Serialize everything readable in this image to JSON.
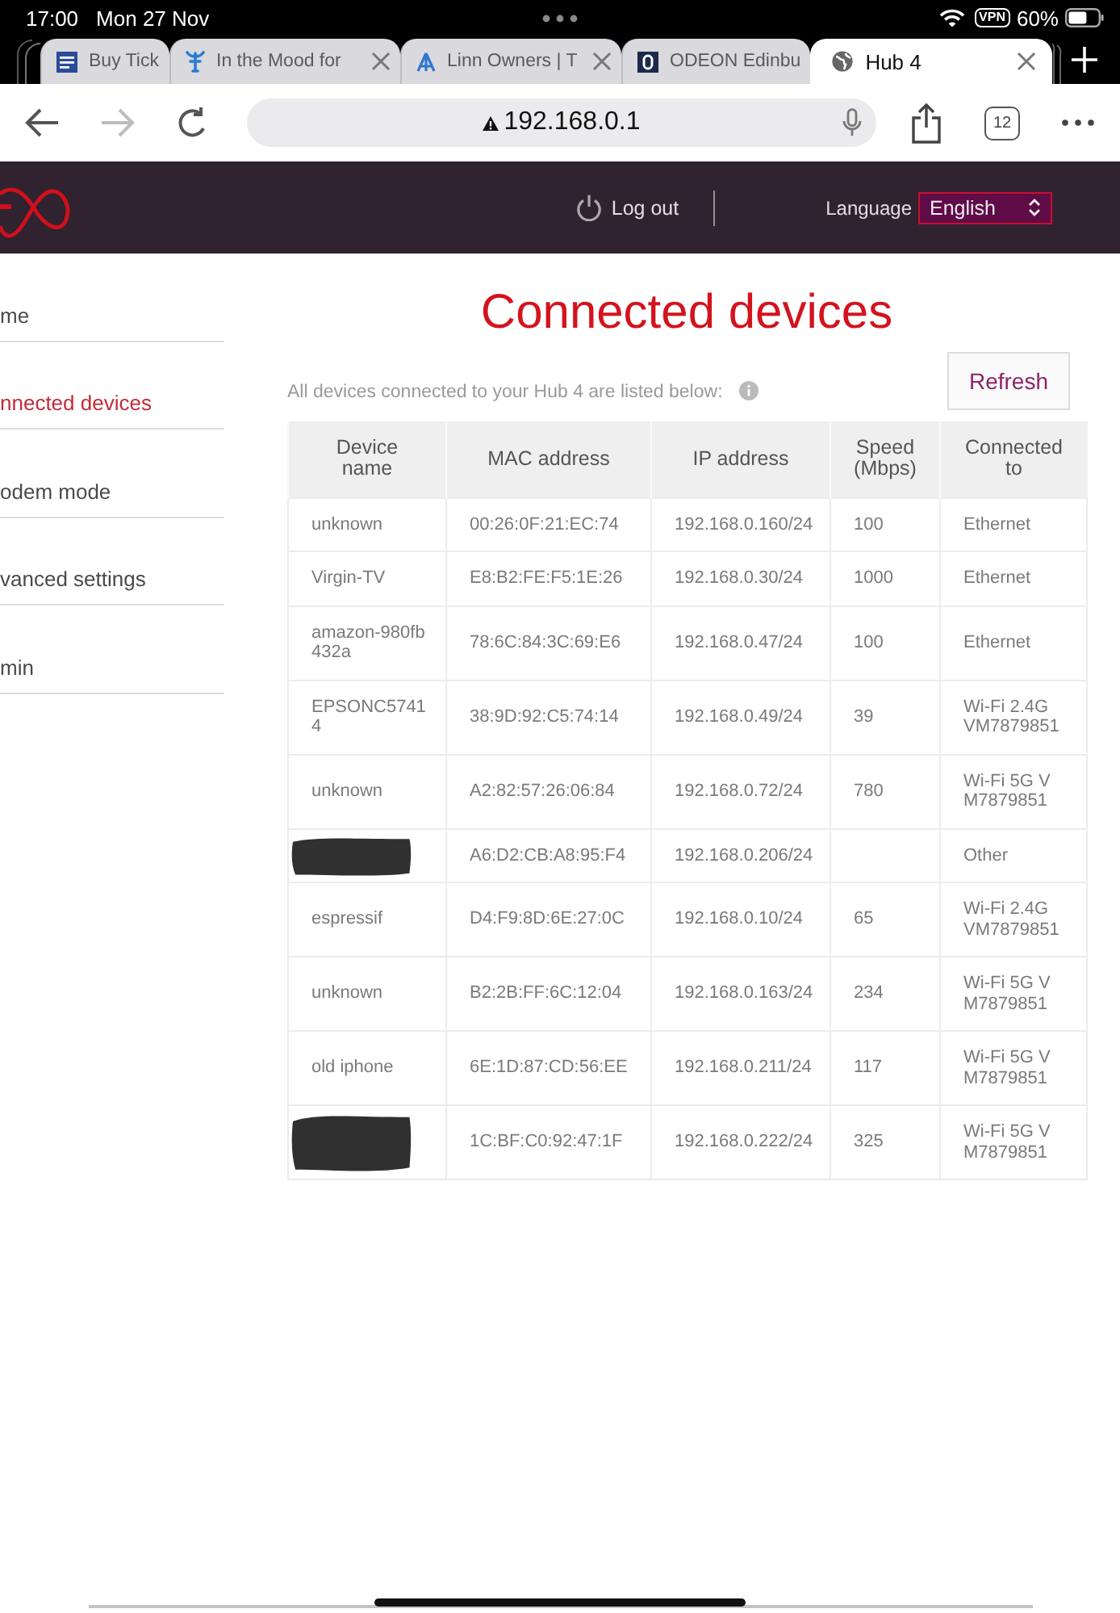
{
  "status_bar": {
    "time": "17:00",
    "date": "Mon 27 Nov",
    "vpn": "VPN",
    "battery": "60%"
  },
  "browser_tabs": [
    {
      "kind": "square",
      "title": "Buy Tick",
      "close_button": false,
      "selected": false
    },
    {
      "kind": "trident",
      "title": "In the Mood for",
      "close_button": true,
      "selected": false
    },
    {
      "kind": "triangle",
      "title": "Linn Owners | T",
      "close_button": true,
      "selected": false
    },
    {
      "kind": "ring",
      "title": "ODEON Edinbu",
      "close_button": false,
      "selected": false
    },
    {
      "kind": "globe",
      "title": "Hub 4",
      "close_button": true,
      "selected": true
    }
  ],
  "toolbar": {
    "nav_buttons": [
      {
        "kind": "back",
        "disabled": false
      },
      {
        "kind": "forward",
        "disabled": true
      },
      {
        "kind": "reload",
        "disabled": false
      }
    ],
    "url": "192.168.0.1",
    "tab_count": "12"
  },
  "site_header": {
    "logout": "Log out",
    "language_label": "Language",
    "language": "English"
  },
  "sidebar": {
    "items": [
      {
        "label": "me",
        "selected": false
      },
      {
        "label": "nnected devices",
        "selected": true
      },
      {
        "label": "odem mode",
        "selected": false
      },
      {
        "label": "vanced settings",
        "selected": false
      },
      {
        "label": "min",
        "selected": false
      }
    ]
  },
  "content": {
    "title": "Connected devices",
    "intro": "All devices connected to your Hub 4 are listed below:",
    "refresh": "Refresh"
  },
  "table": {
    "columns": [
      "Device name",
      "MAC address",
      "IP address",
      "Speed (Mbps)",
      "Connected to"
    ],
    "rows": [
      {
        "redacted": false,
        "device_name": "unknown",
        "mac": "00:26:0F:21:EC:74",
        "ip": "192.168.0.160/24",
        "speed": "100",
        "connected_to": "Ethernet"
      },
      {
        "redacted": false,
        "device_name": "Virgin-TV",
        "mac": "E8:B2:FE:F5:1E:26",
        "ip": "192.168.0.30/24",
        "speed": "1000",
        "connected_to": "Ethernet"
      },
      {
        "redacted": false,
        "device_name": "amazon-980fb432a",
        "mac": "78:6C:84:3C:69:E6",
        "ip": "192.168.0.47/24",
        "speed": "100",
        "connected_to": "Ethernet"
      },
      {
        "redacted": false,
        "device_name": "EPSONC57414",
        "mac": "38:9D:92:C5:74:14",
        "ip": "192.168.0.49/24",
        "speed": "39",
        "connected_to": "Wi-Fi 2.4G VM7879851"
      },
      {
        "redacted": false,
        "device_name": "unknown",
        "mac": "A2:82:57:26:06:84",
        "ip": "192.168.0.72/24",
        "speed": "780",
        "connected_to": "Wi-Fi 5G VM7879851"
      },
      {
        "redacted": true,
        "mac": "A6:D2:CB:A8:95:F4",
        "ip": "192.168.0.206/24",
        "connected_to": "Other"
      },
      {
        "redacted": false,
        "device_name": "espressif",
        "mac": "D4:F9:8D:6E:27:0C",
        "ip": "192.168.0.10/24",
        "speed": "65",
        "connected_to": "Wi-Fi 2.4G VM7879851"
      },
      {
        "redacted": false,
        "device_name": "unknown",
        "mac": "B2:2B:FF:6C:12:04",
        "ip": "192.168.0.163/24",
        "speed": "234",
        "connected_to": "Wi-Fi 5G VM7879851"
      },
      {
        "redacted": false,
        "device_name": "old iphone",
        "mac": "6E:1D:87:CD:56:EE",
        "ip": "192.168.0.211/24",
        "speed": "117",
        "connected_to": "Wi-Fi 5G VM7879851"
      },
      {
        "redacted": true,
        "mac": "1C:BF:C0:92:47:1F",
        "ip": "192.168.0.222/24",
        "speed": "325",
        "connected_to": "Wi-Fi 5G VM7879851"
      }
    ]
  }
}
